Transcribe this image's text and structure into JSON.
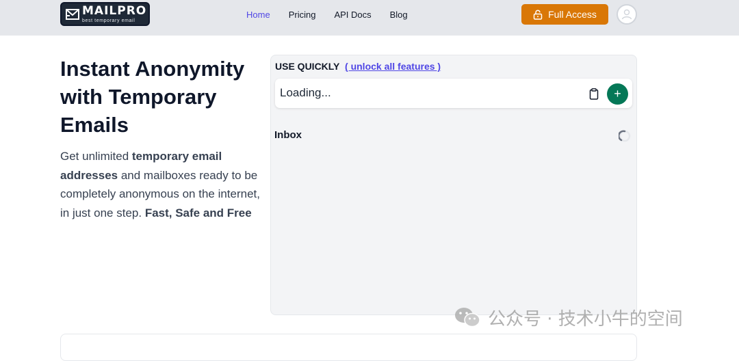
{
  "brand": {
    "name": "MAILPRO",
    "tagline": "best temporary email"
  },
  "nav": {
    "items": [
      {
        "label": "Home",
        "active": true
      },
      {
        "label": "Pricing",
        "active": false
      },
      {
        "label": "API Docs",
        "active": false
      },
      {
        "label": "Blog",
        "active": false
      }
    ]
  },
  "header": {
    "full_access_label": "Full Access"
  },
  "hero": {
    "title": "Instant Anonymity with Temporary Emails",
    "desc_1": "Get unlimited ",
    "desc_bold_1": "temporary email addresses",
    "desc_2": " and mailboxes ready to be completely anonymous on the internet, in just one step. ",
    "desc_bold_2": "Fast, Safe and Free"
  },
  "panel": {
    "heading": "USE QUICKLY",
    "unlock_link": "( unlock all features )",
    "email_value": "Loading...",
    "add_label": "+",
    "inbox_label": "Inbox"
  },
  "watermark": {
    "text": "公众号 · 技术小牛的空间"
  },
  "colors": {
    "header_bg": "#e5e7eb",
    "accent": "#4f46e5",
    "cta": "#d97706",
    "add_button": "#047857",
    "panel_bg": "#f3f4f6"
  },
  "icons": {
    "logo": "envelope-logo-icon",
    "full_access": "lock-icon",
    "avatar": "user-icon",
    "copy": "clipboard-icon",
    "loading": "spinner-icon",
    "watermark": "wechat-icon"
  }
}
